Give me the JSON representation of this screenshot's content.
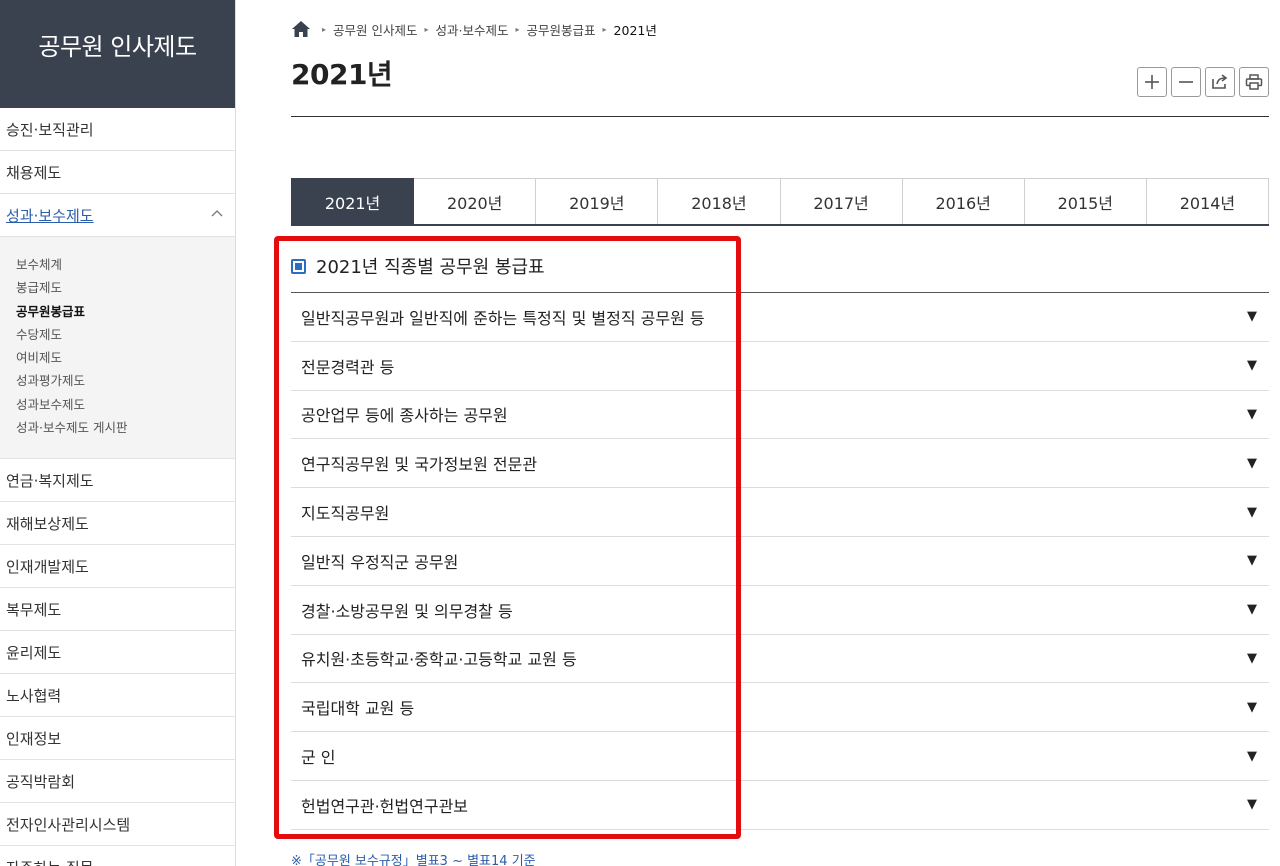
{
  "sidebar": {
    "title": "공무원 인사제도",
    "items_top": [
      {
        "label": "승진·보직관리"
      },
      {
        "label": "채용제도"
      }
    ],
    "active_item": {
      "label": "성과·보수제도",
      "chevron": "chevron-up-icon"
    },
    "submenu": [
      {
        "label": "보수체계"
      },
      {
        "label": "봉급제도"
      },
      {
        "label": "공무원봉급표"
      },
      {
        "label": "수당제도"
      },
      {
        "label": "여비제도"
      },
      {
        "label": "성과평가제도"
      },
      {
        "label": "성과보수제도"
      },
      {
        "label": "성과·보수제도 게시판"
      }
    ],
    "active_submenu_index": 2,
    "items_bottom": [
      {
        "label": "연금·복지제도"
      },
      {
        "label": "재해보상제도"
      },
      {
        "label": "인재개발제도"
      },
      {
        "label": "복무제도"
      },
      {
        "label": "윤리제도"
      },
      {
        "label": "노사협력"
      },
      {
        "label": "인재정보"
      },
      {
        "label": "공직박람회"
      },
      {
        "label": "전자인사관리시스템"
      },
      {
        "label": "자주하는 질문"
      }
    ]
  },
  "breadcrumb": {
    "home_icon": "home-icon",
    "items": [
      "공무원 인사제도",
      "성과·보수제도",
      "공무원봉급표"
    ],
    "current": "2021년"
  },
  "page": {
    "title": "2021년",
    "tools": [
      "zoom-in-icon",
      "zoom-out-icon",
      "share-icon",
      "print-icon"
    ]
  },
  "tabs": [
    {
      "label": "2021년",
      "active": true
    },
    {
      "label": "2020년"
    },
    {
      "label": "2019년"
    },
    {
      "label": "2018년"
    },
    {
      "label": "2017년"
    },
    {
      "label": "2016년"
    },
    {
      "label": "2015년"
    },
    {
      "label": "2014년"
    }
  ],
  "section": {
    "heading": "2021년 직종별 공무원 봉급표",
    "rows": [
      {
        "label": "일반직공무원과 일반직에 준하는 특정직 및 별정직 공무원 등"
      },
      {
        "label": "전문경력관 등"
      },
      {
        "label": "공안업무 등에 종사하는 공무원"
      },
      {
        "label": "연구직공무원 및 국가정보원 전문관"
      },
      {
        "label": "지도직공무원"
      },
      {
        "label": "일반직 우정직군 공무원"
      },
      {
        "label": "경찰·소방공무원 및 의무경찰 등"
      },
      {
        "label": "유치원·초등학교·중학교·고등학교 교원 등"
      },
      {
        "label": "국립대학 교원 등"
      },
      {
        "label": "군 인"
      },
      {
        "label": "헌법연구관·헌법연구관보"
      }
    ],
    "arrow_glyph": "▼",
    "footnote": "※「공무원 보수규정」별표3 ~ 별표14 기준"
  },
  "colors": {
    "sidebar_header": "#3a4250",
    "active_tab": "#3a4250",
    "link_blue": "#2b5dab",
    "highlight_red": "#e30d0d"
  }
}
